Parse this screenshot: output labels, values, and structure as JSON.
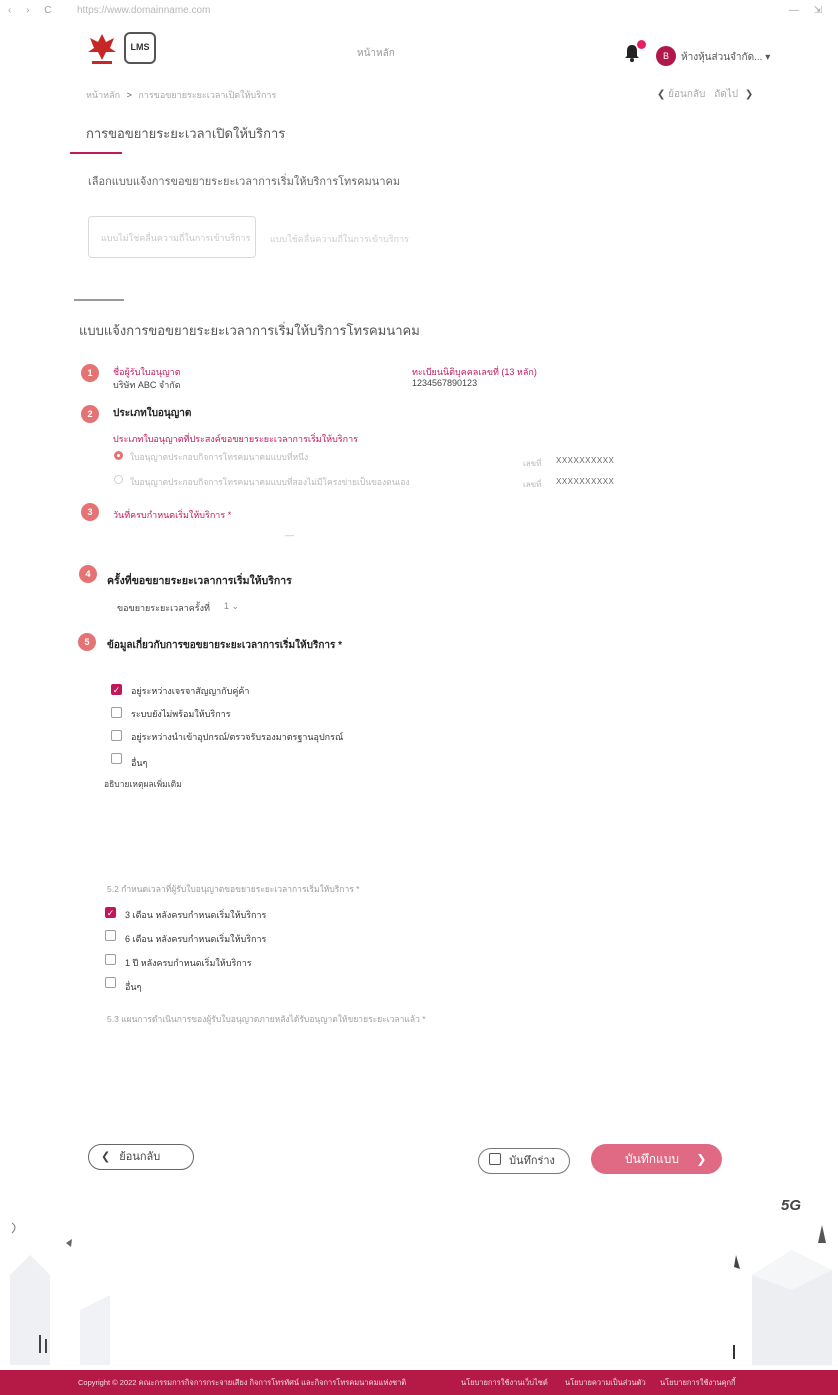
{
  "browser": {
    "url": "https://www.domainname.com",
    "nav_glyphs": "‹ › C",
    "window_glyphs": "— ⇲"
  },
  "header": {
    "logo2_text": "LMS",
    "nav_home": "หน้าหลัก",
    "avatar_letter": "B",
    "username": "ห้างหุ้นส่วนจำกัด...",
    "bell_has_unread": true
  },
  "breadcrumb": {
    "home": "หน้าหลัก",
    "separator": ">",
    "current": "การขอขยายระยะเวลาเปิดให้บริการ"
  },
  "pager": {
    "back": "ย้อนกลับ",
    "next": "ถัดไป"
  },
  "page_title": "การขอขยายระยะเวลาเปิดให้บริการ",
  "select_prompt": "เลือกแบบแจ้งการขอขยายระยะเวลาการเริ่มให้บริการโทรคมนาคม",
  "form_options": [
    {
      "label": "แบบไม่ใช่คลื่นความถี่ในการเข้าบริการ",
      "selected": true
    },
    {
      "label": "แบบใช้คลื่นความถี่ในการเข้าบริการ",
      "selected": false
    }
  ],
  "form_title": "แบบแจ้งการขอขยายระยะเวลาการเริ่มให้บริการโทรคมนาคม",
  "section1": {
    "number": "1",
    "licensee_label": "ชื่อผู้รับใบอนุญาต",
    "licensee_value": "บริษัท ABC จำกัด",
    "taxid_label": "ทะเบียนนิติบุคคลเลขที่ (13 หลัก)",
    "taxid_value": "1234567890123"
  },
  "section2": {
    "number": "2",
    "title": "ประเภทใบอนุญาต",
    "subtitle": "ประเภทใบอนุญาตที่ประสงค์ขอขยายระยะเวลาการเริ่มให้บริการ",
    "options": [
      {
        "label": "ใบอนุญาตประกอบกิจการโทรคมนาคมแบบที่หนึ่ง",
        "no_label": "เลขที่",
        "number": "XXXXXXXXXX",
        "selected": true
      },
      {
        "label": "ใบอนุญาตประกอบกิจการโทรคมนาคมแบบที่สองไม่มีโครงข่ายเป็นของตนเอง",
        "no_label": "เลขที่",
        "number": "XXXXXXXXXX",
        "selected": false
      }
    ]
  },
  "section3": {
    "number": "3",
    "title": "วันที่ครบกำหนดเริ่มให้บริการ *",
    "value": "—"
  },
  "section4": {
    "number": "4",
    "title": "ครั้งที่ขอขยายระยะเวลาการเริ่มให้บริการ",
    "field_label": "ขอขยายระยะเวลาครั้งที่",
    "field_value": "1"
  },
  "section5": {
    "number": "5",
    "title": "ข้อมูลเกี่ยวกับการขอขยายระยะเวลาการเริ่มให้บริการ *",
    "reasons": [
      {
        "label": "อยู่ระหว่างเจรจาสัญญากับคู่ค้า",
        "checked": true
      },
      {
        "label": "ระบบยังไม่พร้อมให้บริการ",
        "checked": false
      },
      {
        "label": "อยู่ระหว่างนำเข้าอุปกรณ์/ตรวจรับรองมาตรฐานอุปกรณ์",
        "checked": false
      },
      {
        "label": "อื่นๆ",
        "checked": false
      }
    ],
    "explain_label": "อธิบายเหตุผลเพิ่มเติม",
    "q52": "5.2 กำหนดเวลาที่ผู้รับใบอนุญาตขอขยายระยะเวลาการเริ่มให้บริการ *",
    "durations": [
      {
        "label": "3 เดือน หลังครบกำหนดเริ่มให้บริการ",
        "checked": true
      },
      {
        "label": "6 เดือน หลังครบกำหนดเริ่มให้บริการ",
        "checked": false
      },
      {
        "label": "1 ปี หลังครบกำหนดเริ่มให้บริการ",
        "checked": false
      },
      {
        "label": "อื่นๆ",
        "checked": false
      }
    ],
    "q53": "5.3 แผนการดำเนินการของผู้รับใบอนุญาตภายหลังได้รับอนุญาตให้ขยายระยะเวลาแล้ว *"
  },
  "actions": {
    "back": "ย้อนกลับ",
    "draft": "บันทึกร่าง",
    "save": "บันทึกแบบ"
  },
  "decor": {
    "badge_5g": "5G"
  },
  "footer": {
    "copyright": "Copyright © 2022 คณะกรรมการกิจการกระจายเสียง กิจการโทรทัศน์ และกิจการโทรคมนาคมแห่งชาติ",
    "link1": "นโยบายการใช้งานเว็บไซต์",
    "link2": "นโยบายความเป็นส่วนตัว",
    "link3": "นโยบายการใช้งานคุกกี้"
  },
  "colors": {
    "accent": "#c2185b",
    "step": "#e57373",
    "save_button": "#e06a83",
    "footer": "#b51a46"
  }
}
